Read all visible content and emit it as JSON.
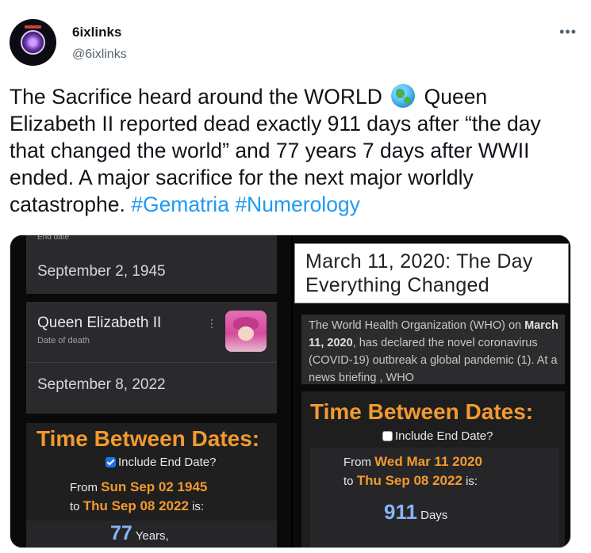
{
  "tweet": {
    "display_name": "6ixlinks",
    "handle": "@6ixlinks",
    "more_icon": "•••",
    "text_part1": "The Sacrifice heard around the WORLD",
    "globe_emoji": "globe-americas-icon",
    "text_part2": "Queen Elizabeth II reported dead exactly 911 days after “the day that changed the world” and 77 years 7 days after WWII ended. A major sacrifice for the next major worldly catastrophe.",
    "hashtags": [
      "#Gematria",
      "#Numerology"
    ]
  },
  "media_left": {
    "end_date_label": "End date",
    "end_date_value": "September 2, 1945",
    "person_name": "Queen Elizabeth II",
    "person_sub": "Date of death",
    "menu_icon": "⋮",
    "death_date": "September 8, 2022",
    "tbd_title": "Time Between Dates:",
    "include_end_label": "Include End Date?",
    "include_end_checked": true,
    "from_label": "From",
    "from_value": "Sun Sep 02 1945",
    "to_label": "to",
    "to_value": "Thu Sep 08 2022",
    "is_label": "is:",
    "result_number": "77",
    "result_unit": "Years,"
  },
  "media_right": {
    "headline": "March 11, 2020: The Day Everything Changed",
    "article_part1": "The World Health Organization (WHO) on",
    "article_bold": "March 11, 2020",
    "article_part2": ", has declared the novel coronavirus (COVID-19) outbreak a global pandemic (1). At a news briefing , WHO",
    "tbd_title": "Time Between Dates:",
    "include_end_label": "Include End Date?",
    "include_end_checked": false,
    "from_label": "From",
    "from_value": "Wed Mar 11 2020",
    "to_label": "to",
    "to_value": "Thu Sep 08 2022",
    "is_label": "is:",
    "result_number": "911",
    "result_unit": "Days"
  },
  "colors": {
    "hashtag": "#1d9bf0",
    "orange": "#f29a2e",
    "result_blue": "#8ab4f8"
  }
}
